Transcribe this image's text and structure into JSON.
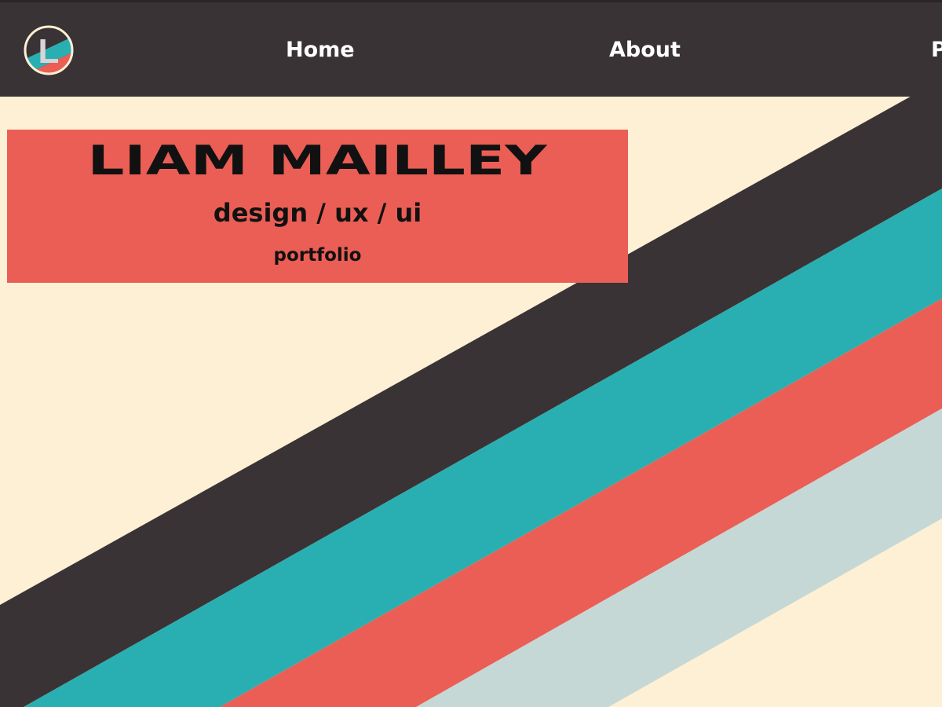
{
  "colors": {
    "navbar": "#3a3335",
    "background": "#fdf0d5",
    "stripe_dark": "#3a3335",
    "stripe_teal": "#29afb1",
    "stripe_coral": "#eb5e55",
    "stripe_pale": "#c5d8d5",
    "card": "#eb5e55",
    "nav_text": "#ffffff"
  },
  "logo": {
    "letter": "L",
    "icon": "circle-l-logo-icon"
  },
  "nav": {
    "home": "Home",
    "about": "About",
    "partial": "P"
  },
  "hero": {
    "name": "LIAM MAILLEY",
    "subtitle": "design / ux / ui",
    "tagline": "portfolio"
  }
}
